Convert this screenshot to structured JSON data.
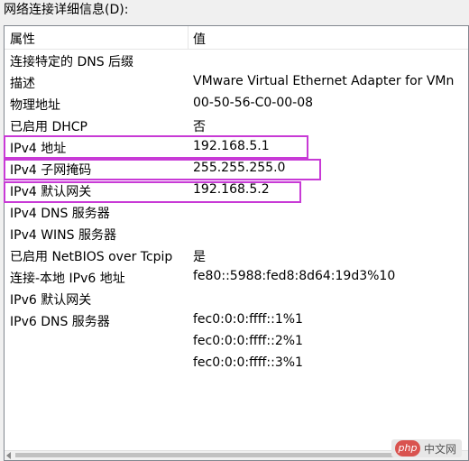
{
  "window": {
    "title": "网络连接详细信息(D):"
  },
  "table": {
    "headers": [
      "属性",
      "值"
    ],
    "rows": [
      {
        "key": "连接特定的 DNS 后缀",
        "value": ""
      },
      {
        "key": "描述",
        "value": "VMware Virtual Ethernet Adapter for VMn"
      },
      {
        "key": "物理地址",
        "value": "00-50-56-C0-00-08"
      },
      {
        "key": "已启用 DHCP",
        "value": "否"
      },
      {
        "key": "IPv4 地址",
        "value": "192.168.5.1"
      },
      {
        "key": "IPv4 子网掩码",
        "value": "255.255.255.0"
      },
      {
        "key": "IPv4 默认网关",
        "value": "192.168.5.2"
      },
      {
        "key": "IPv4 DNS 服务器",
        "value": ""
      },
      {
        "key": "IPv4 WINS 服务器",
        "value": ""
      },
      {
        "key": "已启用 NetBIOS over Tcpip",
        "value": "是"
      },
      {
        "key": "连接-本地 IPv6 地址",
        "value": "fe80::5988:fed8:8d64:19d3%10"
      },
      {
        "key": "IPv6 默认网关",
        "value": ""
      },
      {
        "key": "IPv6 DNS 服务器",
        "value": "fec0:0:0:ffff::1%1"
      },
      {
        "key": "",
        "value": "fec0:0:0:ffff::2%1"
      },
      {
        "key": "",
        "value": "fec0:0:0:ffff::3%1"
      }
    ]
  },
  "watermark": {
    "logo": "php",
    "text": "中文网"
  },
  "colors": {
    "highlight": "#c83ad6"
  }
}
